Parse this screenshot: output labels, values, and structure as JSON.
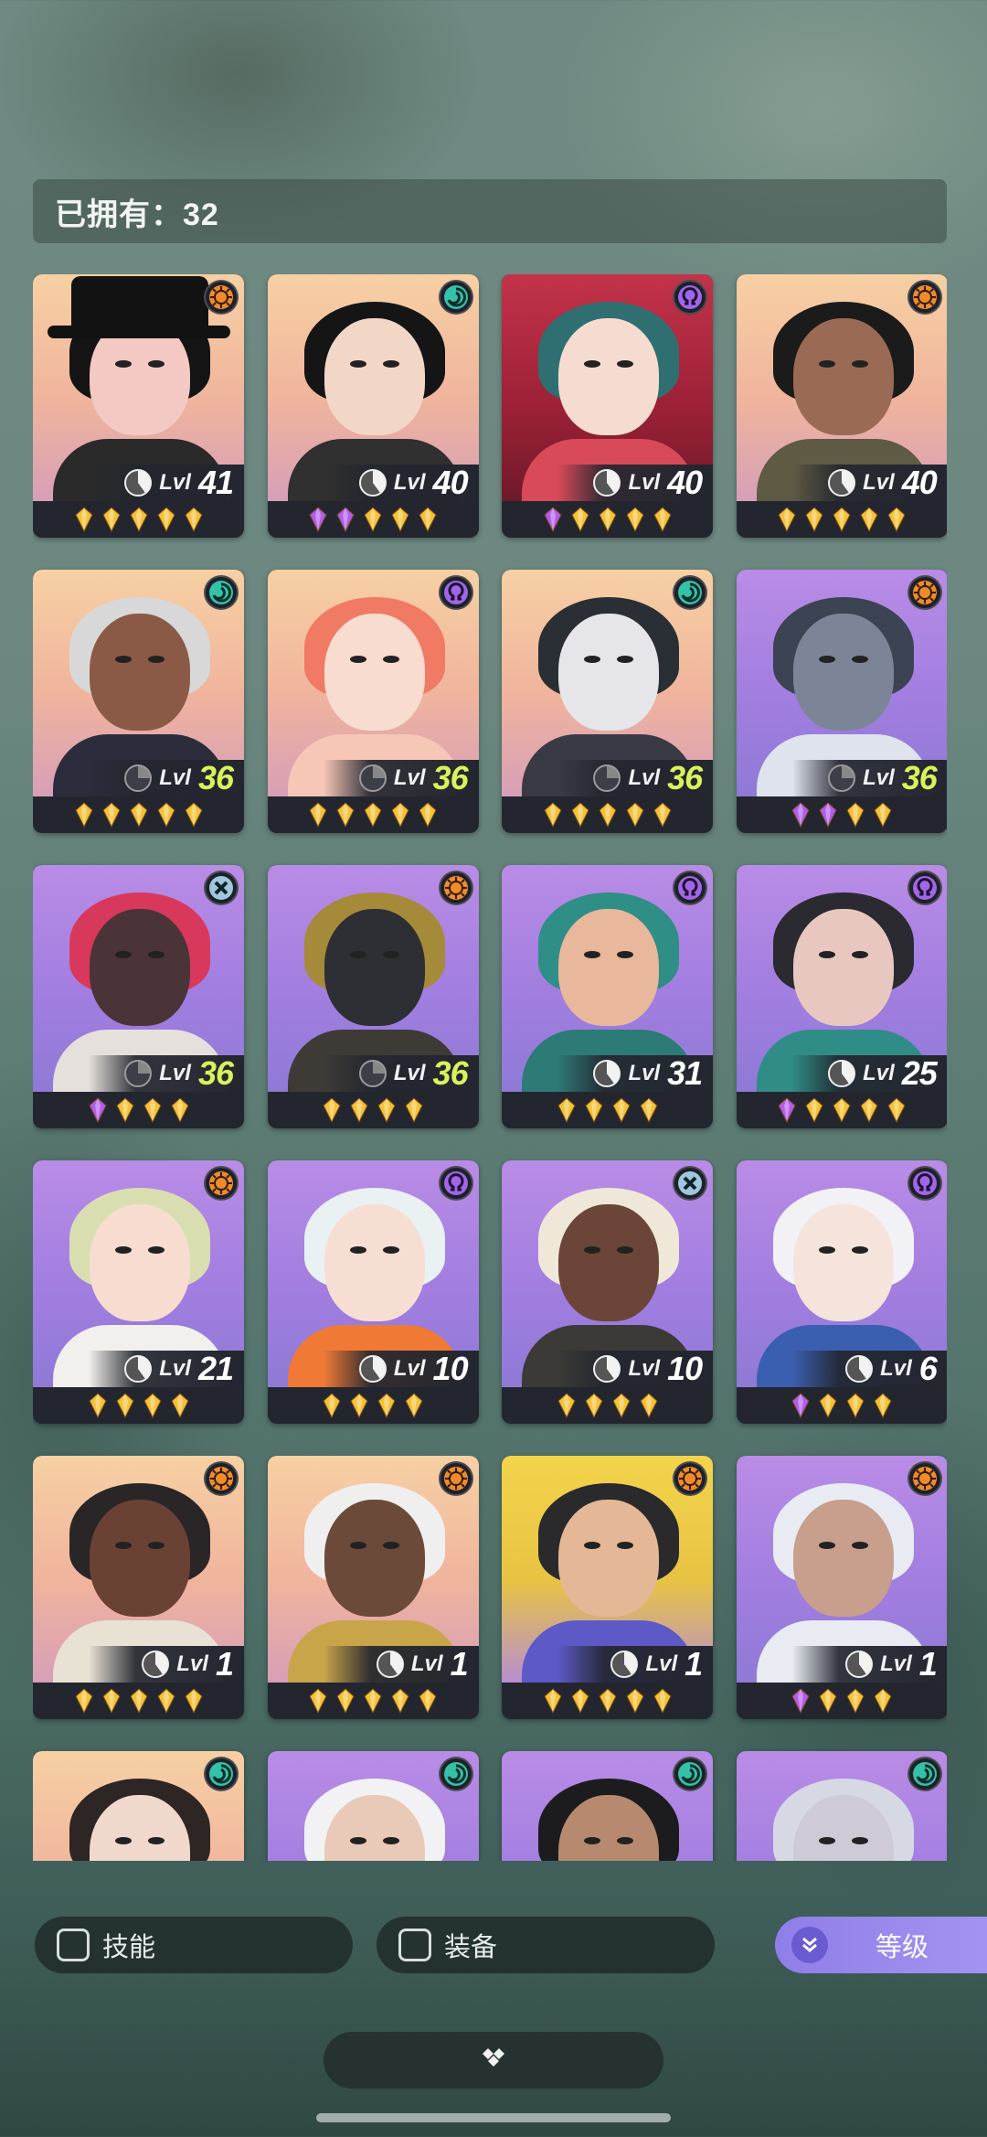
{
  "owned": {
    "label": "已拥有：32"
  },
  "level_prefix": "Lvl",
  "colors": {
    "gold_gem": "#f4c23a",
    "purple_gem": "#b35cf0",
    "accent": "#a593f2",
    "level_highlight": "#d8f25c"
  },
  "cards": [
    {
      "level": "41",
      "faction": "sun-icon",
      "bg": "orange",
      "gold": 5,
      "purple": 0,
      "highlight": false,
      "hair": "#141414",
      "skin": "#f4c9c3",
      "cloth": "#2a2a2a",
      "hat": true
    },
    {
      "level": "40",
      "faction": "wave-icon",
      "bg": "orange",
      "gold": 3,
      "purple": 2,
      "highlight": false,
      "hair": "#151515",
      "skin": "#f3d7c6",
      "cloth": "#303030"
    },
    {
      "level": "40",
      "faction": "omega-icon",
      "bg": "red",
      "gold": 4,
      "purple": 1,
      "highlight": false,
      "hair": "#2f6f72",
      "skin": "#f6dcd0",
      "cloth": "#d94a58"
    },
    {
      "level": "40",
      "faction": "sun-icon",
      "bg": "orange",
      "gold": 5,
      "purple": 0,
      "highlight": false,
      "hair": "#1b1b1b",
      "skin": "#9a6a54",
      "cloth": "#5e5a44"
    },
    {
      "level": "36",
      "faction": "wave-icon",
      "bg": "orange",
      "gold": 5,
      "purple": 0,
      "highlight": true,
      "hair": "#d8d8d8",
      "skin": "#8b5a46",
      "cloth": "#2c2c3c"
    },
    {
      "level": "36",
      "faction": "omega-icon",
      "bg": "orange",
      "gold": 5,
      "purple": 0,
      "highlight": true,
      "hair": "#f07a64",
      "skin": "#f7dccf",
      "cloth": "#f6c6b6"
    },
    {
      "level": "36",
      "faction": "wave-icon",
      "bg": "orange",
      "gold": 5,
      "purple": 0,
      "highlight": true,
      "hair": "#2a2f35",
      "skin": "#e6e6ea",
      "cloth": "#3a3a44"
    },
    {
      "level": "36",
      "faction": "sun-icon",
      "bg": "purple",
      "gold": 2,
      "purple": 2,
      "highlight": true,
      "hair": "#3c4352",
      "skin": "#7c8598",
      "cloth": "#dfe3ee"
    },
    {
      "level": "36",
      "faction": "cross-icon",
      "bg": "purple",
      "gold": 3,
      "purple": 1,
      "highlight": true,
      "hair": "#d8385c",
      "skin": "#4b3438",
      "cloth": "#e6e0dc"
    },
    {
      "level": "36",
      "faction": "sun-icon",
      "bg": "purple",
      "gold": 4,
      "purple": 0,
      "highlight": true,
      "hair": "#a58a3a",
      "skin": "#2e2f34",
      "cloth": "#3e3b36"
    },
    {
      "level": "31",
      "faction": "omega-icon",
      "bg": "purple",
      "gold": 4,
      "purple": 0,
      "highlight": false,
      "hair": "#2f8e86",
      "skin": "#e8b79c",
      "cloth": "#2c7b76"
    },
    {
      "level": "25",
      "faction": "omega-icon",
      "bg": "purple",
      "gold": 4,
      "purple": 1,
      "highlight": false,
      "hair": "#2a2a30",
      "skin": "#e8c7c0",
      "cloth": "#2f8c86"
    },
    {
      "level": "21",
      "faction": "sun-icon",
      "bg": "purple",
      "gold": 4,
      "purple": 0,
      "highlight": false,
      "hair": "#d9deb0",
      "skin": "#f7dccf",
      "cloth": "#f2f0ec"
    },
    {
      "level": "10",
      "faction": "omega-icon",
      "bg": "purple",
      "gold": 4,
      "purple": 0,
      "highlight": false,
      "hair": "#e9f1f3",
      "skin": "#f6dfd2",
      "cloth": "#f07936"
    },
    {
      "level": "10",
      "faction": "cross-icon",
      "bg": "purple",
      "gold": 4,
      "purple": 0,
      "highlight": false,
      "hair": "#efe7d8",
      "skin": "#6b4638",
      "cloth": "#3b3a36"
    },
    {
      "level": "6",
      "faction": "omega-icon",
      "bg": "purple",
      "gold": 3,
      "purple": 1,
      "highlight": false,
      "hair": "#f2f2f6",
      "skin": "#f4e4dc",
      "cloth": "#3b5fb0"
    },
    {
      "level": "1",
      "faction": "sun-icon",
      "bg": "orange",
      "gold": 5,
      "purple": 0,
      "highlight": false,
      "hair": "#2a2628",
      "skin": "#6a4234",
      "cloth": "#e8e2d4"
    },
    {
      "level": "1",
      "faction": "sun-icon",
      "bg": "orange",
      "gold": 5,
      "purple": 0,
      "highlight": false,
      "hair": "#efefef",
      "skin": "#6b4a3a",
      "cloth": "#c9a54a"
    },
    {
      "level": "1",
      "faction": "sun-icon",
      "bg": "yellow",
      "gold": 5,
      "purple": 0,
      "highlight": false,
      "hair": "#2a2a2c",
      "skin": "#e4b896",
      "cloth": "#5d5ac7"
    },
    {
      "level": "1",
      "faction": "sun-icon",
      "bg": "purple",
      "gold": 3,
      "purple": 1,
      "highlight": false,
      "hair": "#e8ecf2",
      "skin": "#c89e8c",
      "cloth": "#e8ecf2"
    },
    {
      "level": "",
      "faction": "wave-icon",
      "bg": "orange",
      "gold": 0,
      "purple": 0,
      "highlight": false,
      "hair": "#2d2624",
      "skin": "#f1d8cc",
      "cloth": "#333"
    },
    {
      "level": "",
      "faction": "wave-icon",
      "bg": "purple",
      "gold": 0,
      "purple": 0,
      "highlight": false,
      "hair": "#f2f2f4",
      "skin": "#e9c9b8",
      "cloth": "#2b3150"
    },
    {
      "level": "",
      "faction": "wave-icon",
      "bg": "purple",
      "gold": 0,
      "purple": 0,
      "highlight": false,
      "hair": "#1c1c1e",
      "skin": "#b78a70",
      "cloth": "#333"
    },
    {
      "level": "",
      "faction": "wave-icon",
      "bg": "purple",
      "gold": 0,
      "purple": 0,
      "highlight": false,
      "hair": "#d6d8e4",
      "skin": "#cfcbd6",
      "cloth": "#9aa0b8"
    }
  ],
  "filters": {
    "skill_label": "技能",
    "equip_label": "装备",
    "sort_label": "等级",
    "sort_icon": "double-chevron-down-icon"
  },
  "collapse_icon": "diamond-cluster-icon"
}
